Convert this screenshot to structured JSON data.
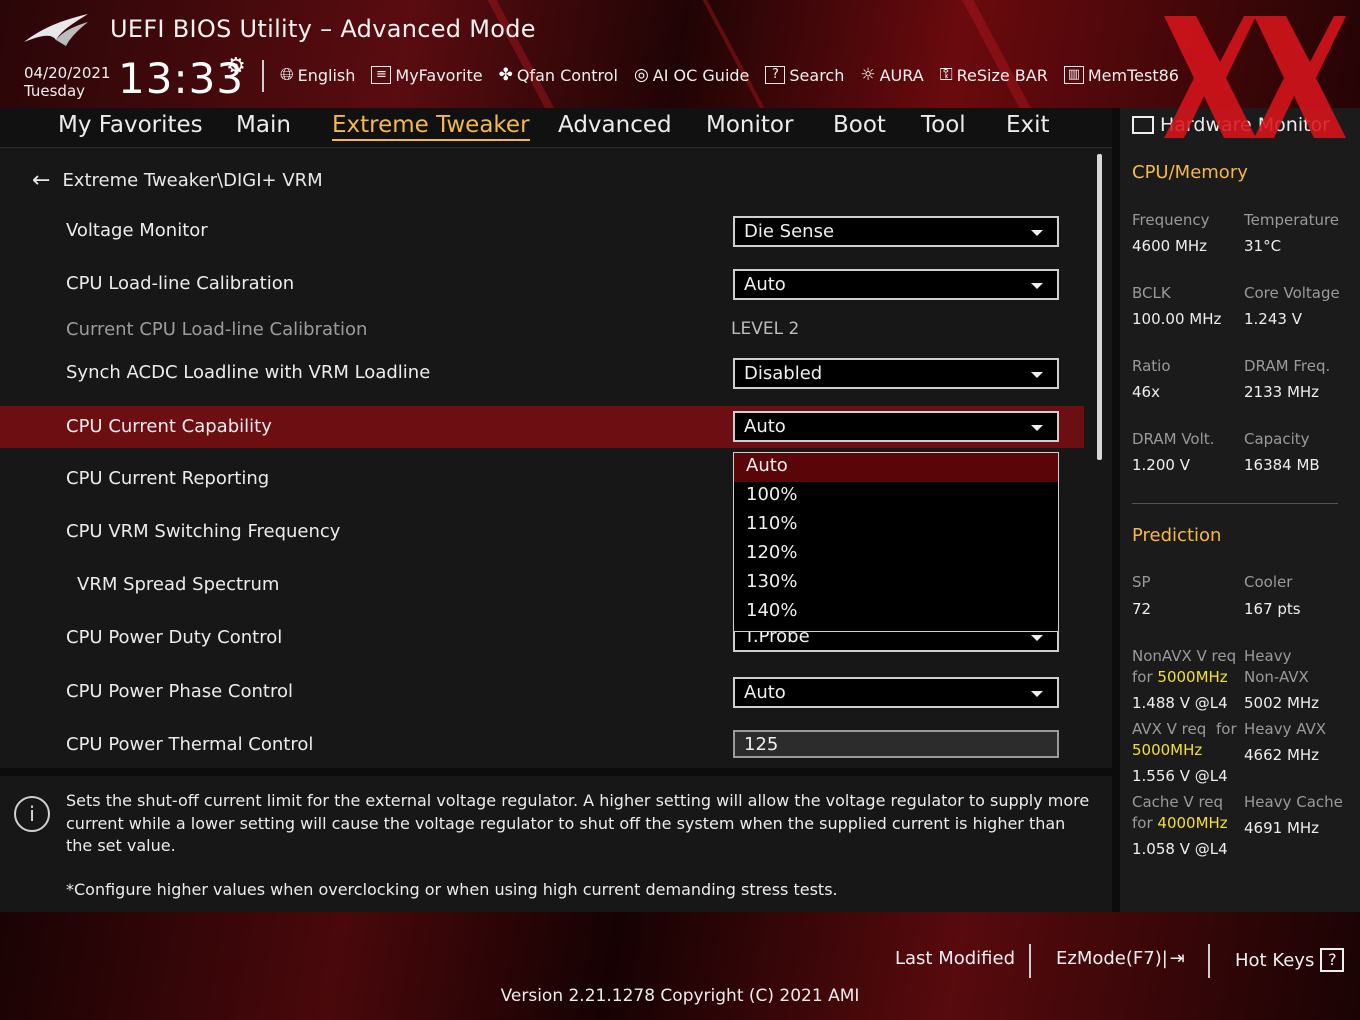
{
  "header": {
    "title": "UEFI BIOS Utility – Advanced Mode",
    "date": "04/20/2021",
    "day": "Tuesday",
    "time": "13:33",
    "tools": [
      {
        "label": "English",
        "icon": "globe-icon"
      },
      {
        "label": "MyFavorite",
        "icon": "favorite-icon"
      },
      {
        "label": "Qfan Control",
        "icon": "fan-icon"
      },
      {
        "label": "AI OC Guide",
        "icon": "ai-guide-icon"
      },
      {
        "label": "Search",
        "icon": "search-icon"
      },
      {
        "label": "AURA",
        "icon": "aura-icon"
      },
      {
        "label": "ReSize BAR",
        "icon": "resize-bar-icon"
      },
      {
        "label": "MemTest86",
        "icon": "memtest-icon"
      }
    ]
  },
  "menu": {
    "items": [
      "My Favorites",
      "Main",
      "Extreme Tweaker",
      "Advanced",
      "Monitor",
      "Boot",
      "Tool",
      "Exit"
    ],
    "active": "Extreme Tweaker"
  },
  "breadcrumb": "Extreme Tweaker\\DIGI+ VRM",
  "settings": [
    {
      "label": "Voltage Monitor",
      "value": "Die Sense",
      "kind": "select"
    },
    {
      "label": "CPU Load-line Calibration",
      "value": "Auto",
      "kind": "select"
    },
    {
      "label": "Current CPU Load-line Calibration",
      "value": "LEVEL 2",
      "kind": "text"
    },
    {
      "label": "Synch ACDC Loadline with VRM Loadline",
      "value": "Disabled",
      "kind": "select"
    },
    {
      "label": "CPU Current Capability",
      "value": "Auto",
      "kind": "select"
    },
    {
      "label": "CPU Current Reporting",
      "value": "",
      "kind": "none"
    },
    {
      "label": "CPU VRM Switching Frequency",
      "value": "",
      "kind": "none"
    },
    {
      "label": "VRM Spread Spectrum",
      "value": "",
      "kind": "none"
    },
    {
      "label": "CPU Power Duty Control",
      "value": "T.Probe",
      "kind": "select"
    },
    {
      "label": "CPU Power Phase Control",
      "value": "Auto",
      "kind": "select"
    },
    {
      "label": "CPU Power Thermal Control",
      "value": "125",
      "kind": "input"
    }
  ],
  "dropdown": {
    "options": [
      "Auto",
      "100%",
      "110%",
      "120%",
      "130%",
      "140%"
    ],
    "selected": "Auto"
  },
  "help": {
    "text": "Sets the shut-off current limit for the external voltage regulator. A higher setting will allow the voltage regulator to supply more current while a lower setting will cause the voltage regulator to shut off the system when the supplied current is higher than the set value.",
    "note": "*Configure higher values when overclocking or when using high current demanding stress tests."
  },
  "hw_monitor": {
    "title": "Hardware Monitor",
    "cpu_section": "CPU/Memory",
    "frequency_label": "Frequency",
    "frequency": "4600 MHz",
    "temperature_label": "Temperature",
    "temperature": "31°C",
    "bclk_label": "BCLK",
    "bclk": "100.00 MHz",
    "core_voltage_label": "Core Voltage",
    "core_voltage": "1.243 V",
    "ratio_label": "Ratio",
    "ratio": "46x",
    "dram_freq_label": "DRAM Freq.",
    "dram_freq": "2133 MHz",
    "dram_volt_label": "DRAM Volt.",
    "dram_volt": "1.200 V",
    "capacity_label": "Capacity",
    "capacity": "16384 MB",
    "prediction_section": "Prediction",
    "sp_label": "SP",
    "sp": "72",
    "cooler_label": "Cooler",
    "cooler": "167 pts",
    "nonavx_req_label": "NonAVX V req",
    "nonavx_for": "for",
    "nonavx_freq": "5000MHz",
    "nonavx_volt": "1.488 V @L4",
    "heavy_nonavx_label1": "Heavy",
    "heavy_nonavx_label2": "Non-AVX",
    "heavy_nonavx": "5002 MHz",
    "avx_req_label": "AVX V req",
    "avx_for": "for",
    "avx_freq": "5000MHz",
    "avx_volt": "1.556 V @L4",
    "heavy_avx_label": "Heavy AVX",
    "heavy_avx": "4662 MHz",
    "cache_req_label": "Cache V req",
    "cache_for": "for",
    "cache_freq": "4000MHz",
    "cache_volt": "1.058 V @L4",
    "heavy_cache_label": "Heavy Cache",
    "heavy_cache": "4691 MHz"
  },
  "footer": {
    "last_modified": "Last Modified",
    "ezmode": "EzMode(F7)|",
    "hot_keys": "Hot Keys",
    "hot_keys_q": "?",
    "version": "Version 2.21.1278 Copyright (C) 2021 AMI"
  },
  "colors": {
    "accent": "#f5b84a",
    "selected_row": "#6d0e13",
    "highlight_freq": "#f2e030"
  }
}
